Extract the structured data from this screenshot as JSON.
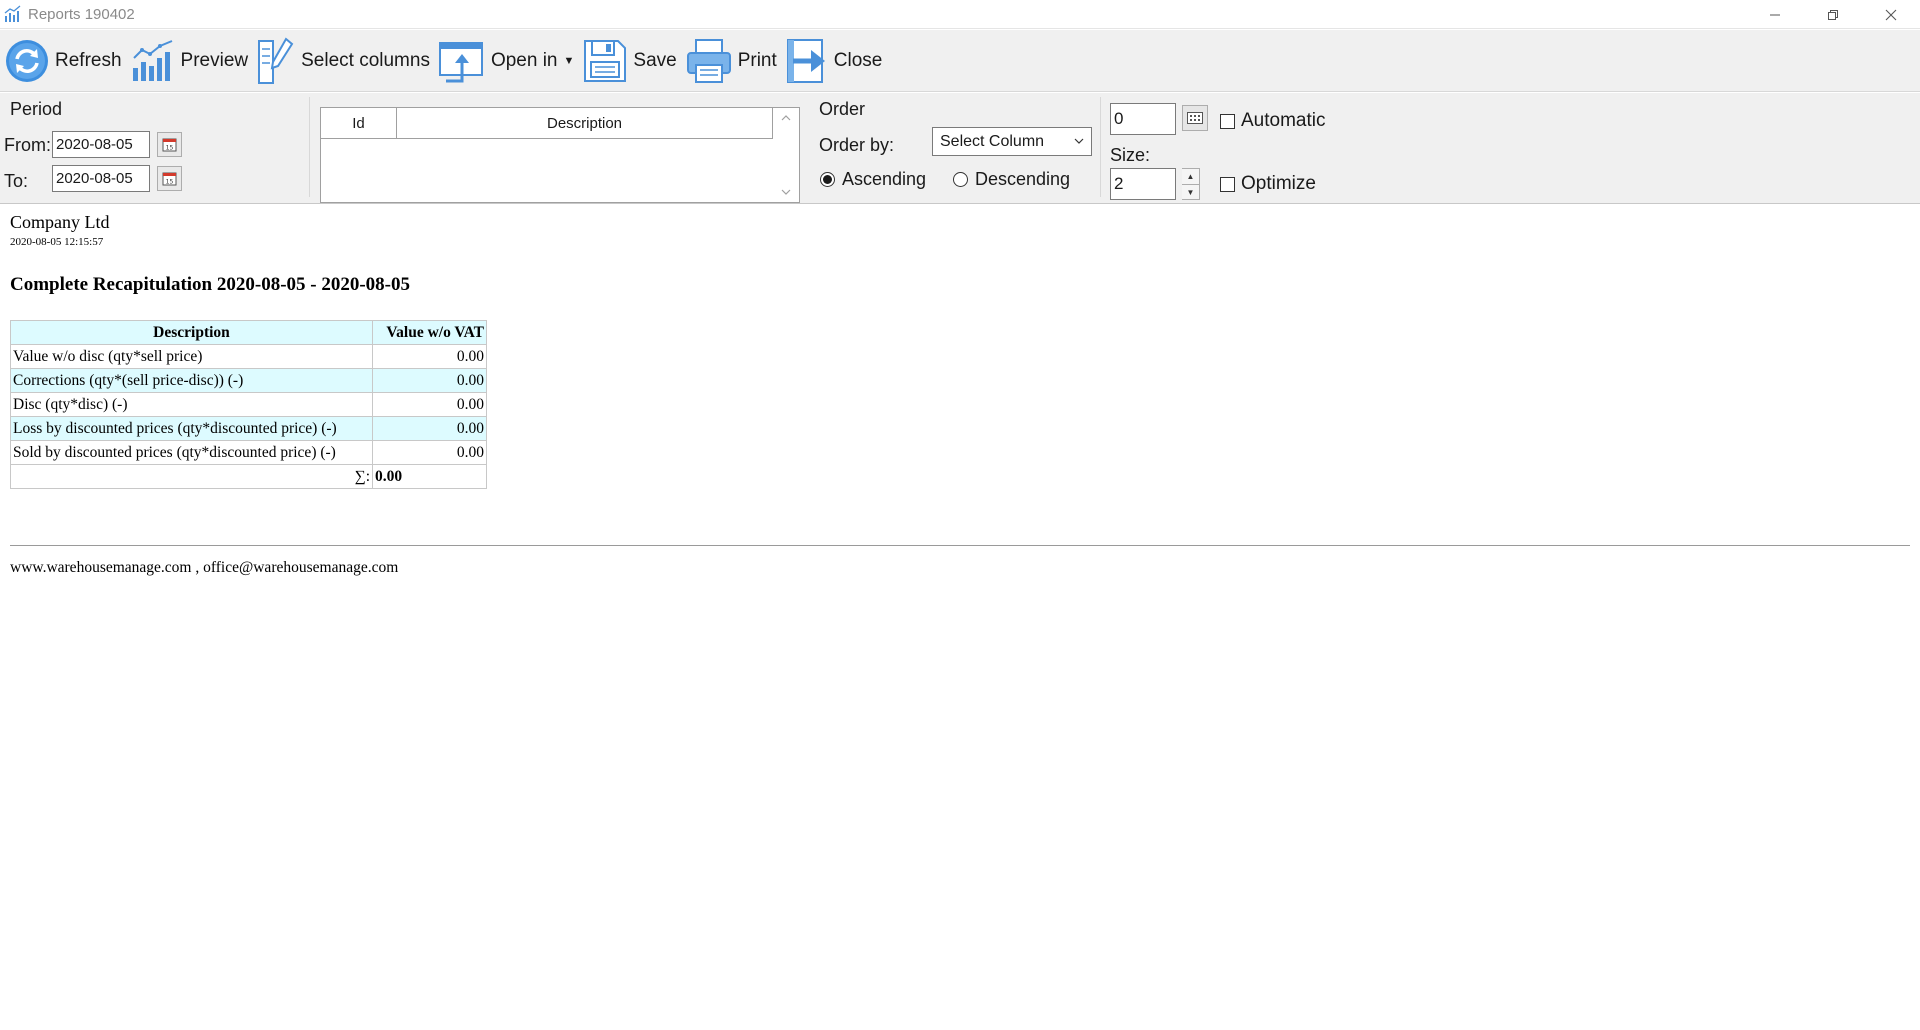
{
  "window": {
    "title": "Reports 190402"
  },
  "toolbar": {
    "refresh": "Refresh",
    "preview": "Preview",
    "select_columns": "Select columns",
    "open_in": "Open in",
    "save": "Save",
    "print": "Print",
    "close": "Close"
  },
  "period": {
    "legend": "Period",
    "from_label": "From:",
    "from_value": "2020-08-05",
    "to_label": "To:",
    "to_value": "2020-08-05"
  },
  "grid": {
    "columns": [
      "Id",
      "Description"
    ]
  },
  "order": {
    "legend": "Order",
    "order_by_label": "Order by:",
    "select_value": "Select Column",
    "ascending": "Ascending",
    "descending": "Descending",
    "selected": "Ascending"
  },
  "options": {
    "count_value": "0",
    "size_label": "Size:",
    "size_value": "2",
    "automatic": "Automatic",
    "optimize": "Optimize"
  },
  "report": {
    "company": "Company Ltd",
    "timestamp": "2020-08-05 12:15:57",
    "title": "Complete Recapitulation 2020-08-05 - 2020-08-05",
    "table": {
      "headers": [
        "Description",
        "Value w/o VAT"
      ],
      "rows": [
        {
          "desc": "Value w/o disc (qty*sell price)",
          "value": "0.00"
        },
        {
          "desc": "Corrections (qty*(sell price-disc)) (-)",
          "value": "0.00"
        },
        {
          "desc": "Disc (qty*disc) (-)",
          "value": "0.00"
        },
        {
          "desc": "Loss by discounted prices (qty*discounted price) (-)",
          "value": "0.00"
        },
        {
          "desc": "Sold by discounted prices (qty*discounted price) (-)",
          "value": "0.00"
        }
      ],
      "sum_label": "∑:",
      "sum_value": "0.00"
    },
    "footer": "www.warehousemanage.com , office@warehousemanage.com"
  },
  "colors": {
    "toolbar_bg": "#f0f0f0",
    "icon_blue": "#4a90d9",
    "table_header_bg": "#ddfbff",
    "calendar_red": "#d33a2c"
  }
}
